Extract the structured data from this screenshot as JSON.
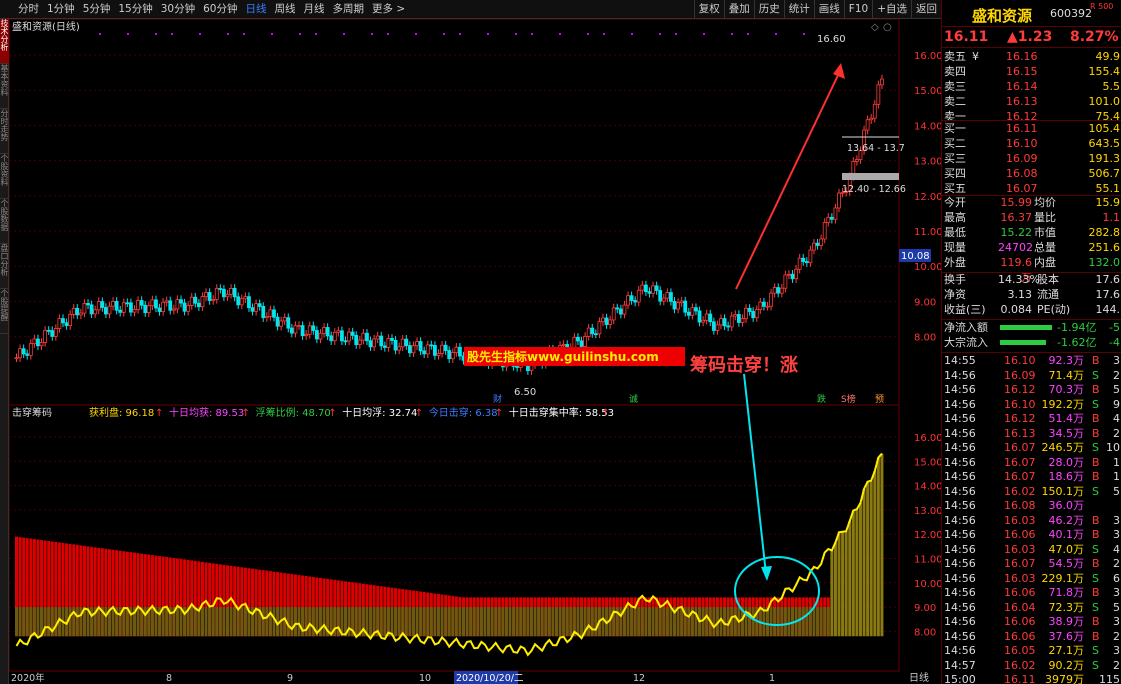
{
  "toolbar": {
    "timeframes": [
      "分时",
      "1分钟",
      "5分钟",
      "15分钟",
      "30分钟",
      "60分钟",
      "日线",
      "周线",
      "月线",
      "多周期",
      "更多 >"
    ],
    "active": "日线",
    "buttons": [
      "复权",
      "叠加",
      "历史",
      "统计",
      "画线",
      "F10",
      "+自选",
      "返回"
    ]
  },
  "sidebar": [
    "技术分析",
    "基本资料",
    "分时走势",
    "个股资料",
    "个股数据",
    "盘口分析",
    "个股提醒"
  ],
  "main": {
    "title": "盛和资源(日线)",
    "price_labels": [
      "16.00",
      "15.00",
      "14.00",
      "13.00",
      "12.00",
      "11.00",
      "10.00",
      "9.00",
      "8.00"
    ],
    "current": "10.08",
    "high_marker": "16.60",
    "low_marker": "6.50",
    "range_a": "13.64 - 13.7",
    "range_b": "12.40 - 12.66",
    "watermark": "股先生指标www.guilinshu.com",
    "annotation": "筹码击穿！涨",
    "markers": [
      "财",
      "诚",
      "跌",
      "S榜",
      "预"
    ],
    "tool_icons": [
      "◇",
      "○"
    ]
  },
  "indicator": {
    "name": "击穿筹码",
    "items": [
      {
        "label": "获利盘: 96.18",
        "arrow": "↑",
        "color": "#ffd700"
      },
      {
        "label": "十日均获: 89.53",
        "arrow": "↑",
        "color": "#ff44ff"
      },
      {
        "label": "浮筹比例: 48.70",
        "arrow": "↑",
        "color": "#2ecc40"
      },
      {
        "label": "十日均浮: 32.74",
        "arrow": "↑",
        "color": "#ffffff"
      },
      {
        "label": "今日击穿: 6.38",
        "arrow": "↑",
        "color": "#3a7dff"
      },
      {
        "label": "十日击穿集中率: 58.53",
        "arrow": "↑",
        "color": "#ffffff"
      }
    ],
    "price_labels": [
      "16.00",
      "15.00",
      "14.00",
      "13.00",
      "12.00",
      "11.00",
      "10.00",
      "9.00",
      "8.00"
    ]
  },
  "xaxis": {
    "labels": [
      "2020年",
      "8",
      "9",
      "10",
      "2020/10/20/二",
      "12",
      "1"
    ],
    "period": "日线"
  },
  "quote": {
    "name": "盛和资源",
    "code": "600392",
    "sub": "R 500",
    "price": "16.11",
    "change": "▲1.23",
    "pct": "8.27%"
  },
  "orderbook": {
    "asks": [
      [
        "卖五",
        "16.16",
        "49.9"
      ],
      [
        "卖四",
        "16.15",
        "155.4"
      ],
      [
        "卖三",
        "16.14",
        "5.5"
      ],
      [
        "卖二",
        "16.13",
        "101.0"
      ],
      [
        "卖一",
        "16.12",
        "75.4"
      ]
    ],
    "ask_marker": "¥",
    "bids": [
      [
        "买一",
        "16.11",
        "105.4"
      ],
      [
        "买二",
        "16.10",
        "643.5"
      ],
      [
        "买三",
        "16.09",
        "191.3"
      ],
      [
        "买四",
        "16.08",
        "506.7"
      ],
      [
        "买五",
        "16.07",
        "55.1"
      ]
    ]
  },
  "stats": [
    [
      "今开",
      "15.99",
      "均价",
      "15.9"
    ],
    [
      "最高",
      "16.37",
      "量比",
      "1.1"
    ],
    [
      "最低",
      "15.22",
      "市值",
      "282.8"
    ],
    [
      "现量",
      "24702",
      "总量",
      "251.6"
    ],
    [
      "外盘",
      "119.6万",
      "内盘",
      "132.0"
    ]
  ],
  "stats2": [
    [
      "换手",
      "14.33%",
      "股本",
      "17.6"
    ],
    [
      "净资",
      "3.13",
      "流通",
      "17.6"
    ],
    [
      "收益(三)",
      "0.084",
      "PE(动)",
      "144."
    ]
  ],
  "flows": [
    [
      "净流入额",
      "-1.94亿",
      "-5"
    ],
    [
      "大宗流入",
      "-1.62亿",
      "-4"
    ]
  ],
  "ticks": [
    [
      "14:55",
      "16.10",
      "92.3万",
      "B",
      "3"
    ],
    [
      "14:56",
      "16.09",
      "71.4万",
      "S",
      "2"
    ],
    [
      "14:56",
      "16.12",
      "70.3万",
      "B",
      "5"
    ],
    [
      "14:56",
      "16.10",
      "192.2万",
      "S",
      "9"
    ],
    [
      "14:56",
      "16.12",
      "51.4万",
      "B",
      "4"
    ],
    [
      "14:56",
      "16.13",
      "34.5万",
      "B",
      "2"
    ],
    [
      "14:56",
      "16.07",
      "246.5万",
      "S",
      "10"
    ],
    [
      "14:56",
      "16.07",
      "28.0万",
      "B",
      "1"
    ],
    [
      "14:56",
      "16.07",
      "18.6万",
      "B",
      "1"
    ],
    [
      "14:56",
      "16.02",
      "150.1万",
      "S",
      "5"
    ],
    [
      "14:56",
      "16.08",
      "36.0万",
      "",
      ""
    ],
    [
      "14:56",
      "16.03",
      "46.2万",
      "B",
      "3"
    ],
    [
      "14:56",
      "16.06",
      "40.1万",
      "B",
      "3"
    ],
    [
      "14:56",
      "16.03",
      "47.0万",
      "S",
      "4"
    ],
    [
      "14:56",
      "16.07",
      "54.5万",
      "B",
      "2"
    ],
    [
      "14:56",
      "16.03",
      "229.1万",
      "S",
      "6"
    ],
    [
      "14:56",
      "16.06",
      "71.8万",
      "B",
      "3"
    ],
    [
      "14:56",
      "16.04",
      "72.3万",
      "S",
      "5"
    ],
    [
      "14:56",
      "16.06",
      "38.9万",
      "B",
      "3"
    ],
    [
      "14:56",
      "16.06",
      "37.6万",
      "B",
      "2"
    ],
    [
      "14:56",
      "16.05",
      "27.1万",
      "S",
      "3"
    ],
    [
      "14:57",
      "16.02",
      "90.2万",
      "S",
      "2"
    ],
    [
      "15:00",
      "16.11",
      "3979万",
      "",
      "115"
    ]
  ]
}
